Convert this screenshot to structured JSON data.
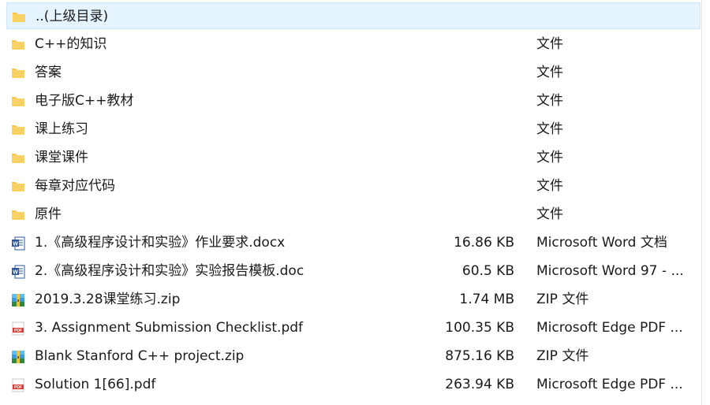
{
  "colors": {
    "selection_bg": "#e5f3ff",
    "folder": "#f8c74a",
    "word": "#2b579a",
    "pdf": "#d83b2b"
  },
  "rows": [
    {
      "name": "..(上级目录)",
      "size": "",
      "type": "",
      "icon": "folder-icon",
      "selected": true
    },
    {
      "name": "C++的知识",
      "size": "",
      "type": "文件",
      "icon": "folder-icon"
    },
    {
      "name": "答案",
      "size": "",
      "type": "文件",
      "icon": "folder-icon"
    },
    {
      "name": "电子版C++教材",
      "size": "",
      "type": "文件",
      "icon": "folder-icon"
    },
    {
      "name": "课上练习",
      "size": "",
      "type": "文件",
      "icon": "folder-icon"
    },
    {
      "name": "课堂课件",
      "size": "",
      "type": "文件",
      "icon": "folder-icon"
    },
    {
      "name": "每章对应代码",
      "size": "",
      "type": "文件",
      "icon": "folder-icon"
    },
    {
      "name": "原件",
      "size": "",
      "type": "文件",
      "icon": "folder-icon"
    },
    {
      "name": "1.《高级程序设计和实验》作业要求.docx",
      "size": "16.86 KB",
      "type": "Microsoft Word 文档",
      "icon": "word-doc-icon"
    },
    {
      "name": "2.《高级程序设计和实验》实验报告模板.doc",
      "size": "60.5 KB",
      "type": "Microsoft Word 97 - ...",
      "icon": "word-doc-icon"
    },
    {
      "name": "2019.3.28课堂练习.zip",
      "size": "1.74 MB",
      "type": "ZIP 文件",
      "icon": "zip-icon"
    },
    {
      "name": "3. Assignment Submission Checklist.pdf",
      "size": "100.35 KB",
      "type": "Microsoft Edge PDF ...",
      "icon": "pdf-icon"
    },
    {
      "name": "Blank Stanford C++ project.zip",
      "size": "875.16 KB",
      "type": "ZIP 文件",
      "icon": "zip-icon"
    },
    {
      "name": "Solution 1[66].pdf",
      "size": "263.94 KB",
      "type": "Microsoft Edge PDF ...",
      "icon": "pdf-icon"
    }
  ]
}
